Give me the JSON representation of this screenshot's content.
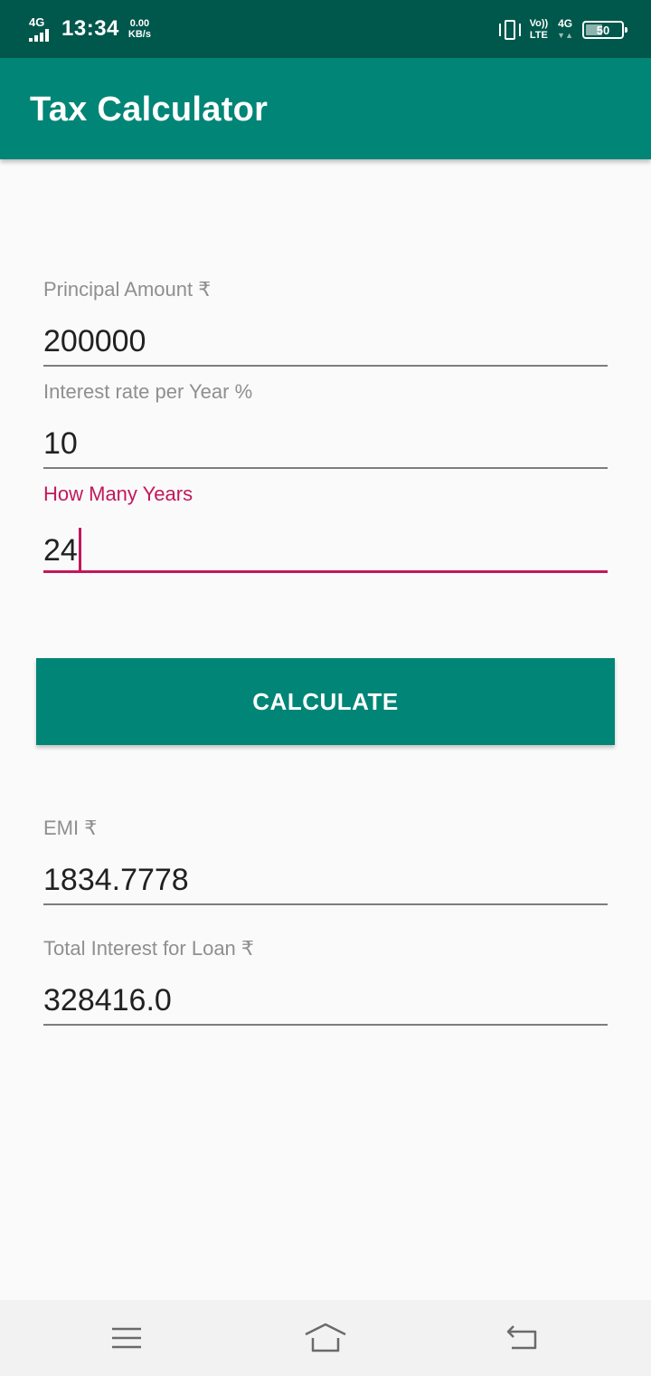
{
  "status_bar": {
    "network_type": "4G",
    "time": "13:34",
    "data_speed_value": "0.00",
    "data_speed_unit": "KB/s",
    "volte_top": "Vo))",
    "volte_bottom": "LTE",
    "signal_label": "4G",
    "battery_level": "50"
  },
  "app_bar": {
    "title": "Tax Calculator",
    "color": "#008577"
  },
  "form": {
    "principal": {
      "label": "Principal Amount ₹",
      "value": "200000"
    },
    "interest_rate": {
      "label": "Interest rate per Year %",
      "value": "10"
    },
    "years": {
      "label": "How Many Years",
      "value": "24",
      "focused": true
    }
  },
  "calculate_button": {
    "label": "CALCULATE"
  },
  "results": {
    "emi": {
      "label": "EMI ₹",
      "value": "1834.7778"
    },
    "total_interest": {
      "label": "Total Interest for Loan ₹",
      "value": "328416.0"
    }
  },
  "nav_bar": {
    "icons": [
      "menu-icon",
      "home-icon",
      "back-icon"
    ]
  },
  "colors": {
    "status_bar": "#00574b",
    "primary": "#008577",
    "accent": "#c2185b",
    "background": "#fafafa"
  }
}
